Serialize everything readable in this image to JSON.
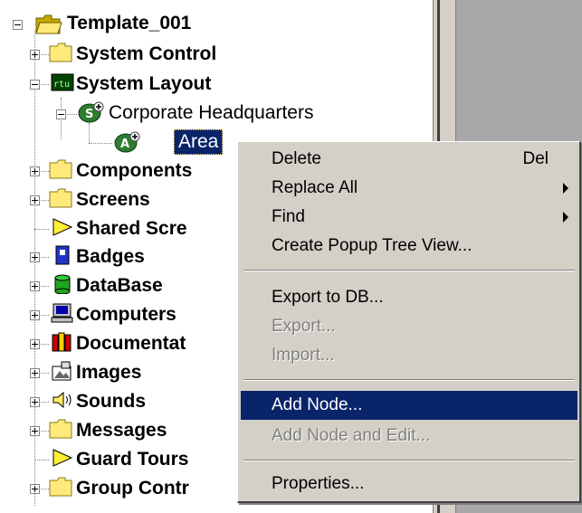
{
  "tree": {
    "root": "Template_001",
    "items": [
      {
        "label": "System Control"
      },
      {
        "label": "System Layout"
      },
      {
        "label": "Corporate Headquarters"
      },
      {
        "label": "Area"
      },
      {
        "label": "Components"
      },
      {
        "label": "Screens"
      },
      {
        "label": "Shared Scre"
      },
      {
        "label": "Badges"
      },
      {
        "label": "DataBase"
      },
      {
        "label": "Computers"
      },
      {
        "label": "Documentat"
      },
      {
        "label": "Images"
      },
      {
        "label": "Sounds"
      },
      {
        "label": "Messages"
      },
      {
        "label": "Guard Tours"
      },
      {
        "label": "Group Contr"
      }
    ],
    "icon_text": {
      "rtu": "rtu",
      "s": "S",
      "a": "A"
    }
  },
  "context_menu": {
    "items": [
      {
        "label": "Delete",
        "shortcut": "Del"
      },
      {
        "label": "Replace All"
      },
      {
        "label": "Find"
      },
      {
        "label": "Create Popup Tree View..."
      },
      {
        "label": "Export to DB..."
      },
      {
        "label": "Export..."
      },
      {
        "label": "Import..."
      },
      {
        "label": "Add Node..."
      },
      {
        "label": "Add Node and Edit..."
      },
      {
        "label": "Properties..."
      }
    ]
  },
  "colors": {
    "selection": "#0a246a",
    "menu_bg": "#d4d0c8",
    "folder": "#ffe97a",
    "disabled_text": "#808080"
  }
}
